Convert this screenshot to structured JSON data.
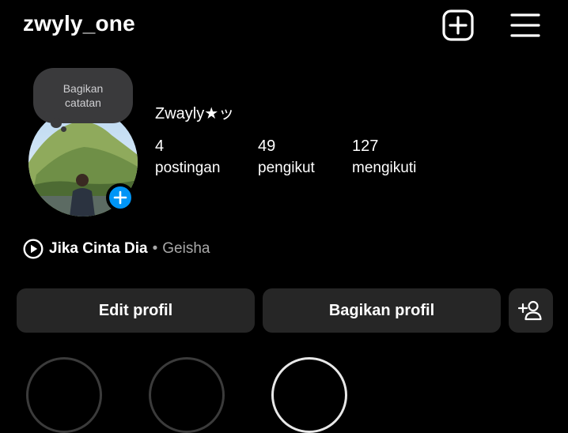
{
  "header": {
    "username": "zwyly_one",
    "new_post_icon": "plus-square-icon",
    "menu_icon": "hamburger-menu-icon"
  },
  "note": {
    "line1": "Bagikan",
    "line2": "catatan"
  },
  "profile": {
    "display_name": "Zwayly★ッ",
    "stats": [
      {
        "value": "4",
        "label": "postingan"
      },
      {
        "value": "49",
        "label": "pengikut"
      },
      {
        "value": "127",
        "label": "mengikuti"
      }
    ]
  },
  "music": {
    "icon": "play-circle-icon",
    "song": "Jika Cinta Dia",
    "separator": "•",
    "artist": "Geisha"
  },
  "actions": {
    "edit_label": "Edit profil",
    "share_label": "Bagikan profil",
    "add_person_icon": "add-person-icon"
  },
  "colors": {
    "background": "#000000",
    "button_bg": "#262626",
    "accent_blue": "#0095f6",
    "note_bg": "#3a3a3c",
    "muted_text": "#a8a8a8"
  }
}
